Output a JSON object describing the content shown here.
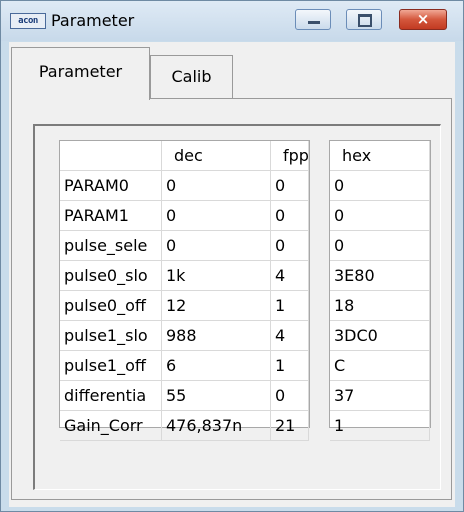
{
  "window": {
    "title": "Parameter",
    "app_icon_text": "acon",
    "close_glyph": "×"
  },
  "tabs": [
    {
      "label": "Parameter",
      "active": true
    },
    {
      "label": "Calib",
      "active": false
    }
  ],
  "table": {
    "columns": {
      "name": "",
      "dec": "dec",
      "fpp": "fpp",
      "hex": "hex"
    },
    "rows": [
      {
        "name": "PARAM0",
        "dec": "0",
        "fpp": "0",
        "hex": "0"
      },
      {
        "name": "PARAM1",
        "dec": "0",
        "fpp": "0",
        "hex": "0"
      },
      {
        "name": "pulse_sele",
        "dec": "0",
        "fpp": "0",
        "hex": "0"
      },
      {
        "name": "pulse0_slo",
        "dec": "1k",
        "fpp": "4",
        "hex": "3E80"
      },
      {
        "name": "pulse0_off",
        "dec": "12",
        "fpp": "1",
        "hex": "18"
      },
      {
        "name": "pulse1_slo",
        "dec": "988",
        "fpp": "4",
        "hex": "3DC0"
      },
      {
        "name": "pulse1_off",
        "dec": "6",
        "fpp": "1",
        "hex": "C"
      },
      {
        "name": "differentia",
        "dec": "55",
        "fpp": "0",
        "hex": "37"
      },
      {
        "name": "Gain_Corr",
        "dec": "476,837n",
        "fpp": "21",
        "hex": "1"
      }
    ]
  },
  "colors": {
    "titlebar": "#c9dceb",
    "close_button": "#c23a22",
    "grid_border": "#a8a8a8"
  }
}
